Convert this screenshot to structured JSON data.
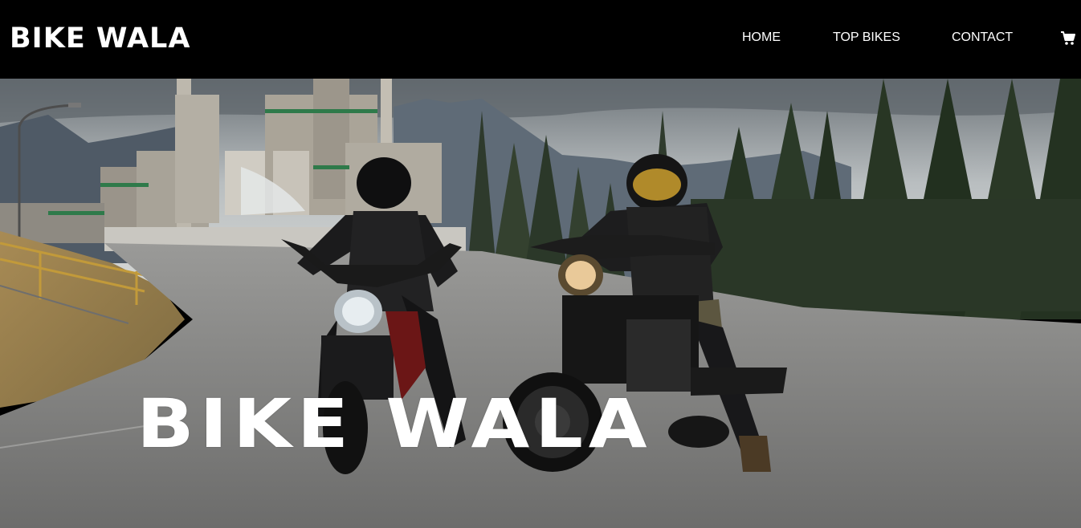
{
  "brand": {
    "logo_text": "BIKE WALA"
  },
  "nav": {
    "items": [
      {
        "label": "HOME"
      },
      {
        "label": "TOP BIKES"
      },
      {
        "label": "CONTACT"
      }
    ],
    "cart_icon": "shopping-cart-icon"
  },
  "hero": {
    "title": "BIKE WALA",
    "image_subject": "two motorcyclists on motorcycles on a road with factory, mountains and pine trees in background"
  },
  "colors": {
    "navbar_bg": "#000000",
    "text": "#ffffff"
  }
}
